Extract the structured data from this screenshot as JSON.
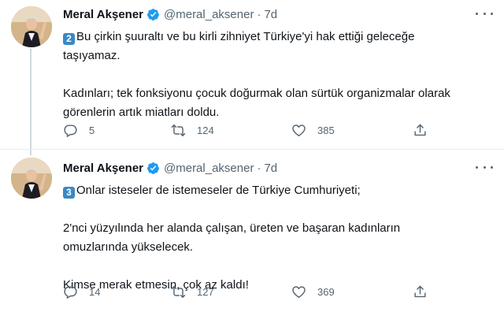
{
  "colors": {
    "verified": "#1d9bf0",
    "keycap": "#3b88c3",
    "text_primary": "#0f1419",
    "text_secondary": "#536471",
    "divider": "#e6ecf0"
  },
  "tweets": [
    {
      "author_name": "Meral Akşener",
      "handle": "@meral_aksener",
      "separator": "·",
      "time": "7d",
      "keycap_number": "2",
      "lines": [
        "Bu çirkin şuuraltı ve bu kirli zihniyet Türkiye'yi hak ettiği geleceğe",
        "taşıyamaz.",
        "",
        "Kadınları; tek fonksiyonu çocuk doğurmak olan sürtük organizmalar olarak",
        "görenlerin artık miatları doldu."
      ],
      "replies": "5",
      "retweets": "124",
      "likes": "385",
      "icons": [
        "reply-icon",
        "retweet-icon",
        "like-icon",
        "share-icon"
      ]
    },
    {
      "author_name": "Meral Akşener",
      "handle": "@meral_aksener",
      "separator": "·",
      "time": "7d",
      "keycap_number": "3",
      "lines": [
        "Onlar isteseler de istemeseler de Türkiye Cumhuriyeti;",
        "",
        "2'nci yüzyılında her alanda çalışan, üreten ve başaran kadınların",
        "omuzlarında yükselecek.",
        "",
        "Kimse merak etmesin, çok az kaldı!"
      ],
      "replies": "14",
      "retweets": "127",
      "likes": "369",
      "icons": [
        "reply-icon",
        "retweet-icon",
        "like-icon",
        "share-icon"
      ]
    }
  ]
}
